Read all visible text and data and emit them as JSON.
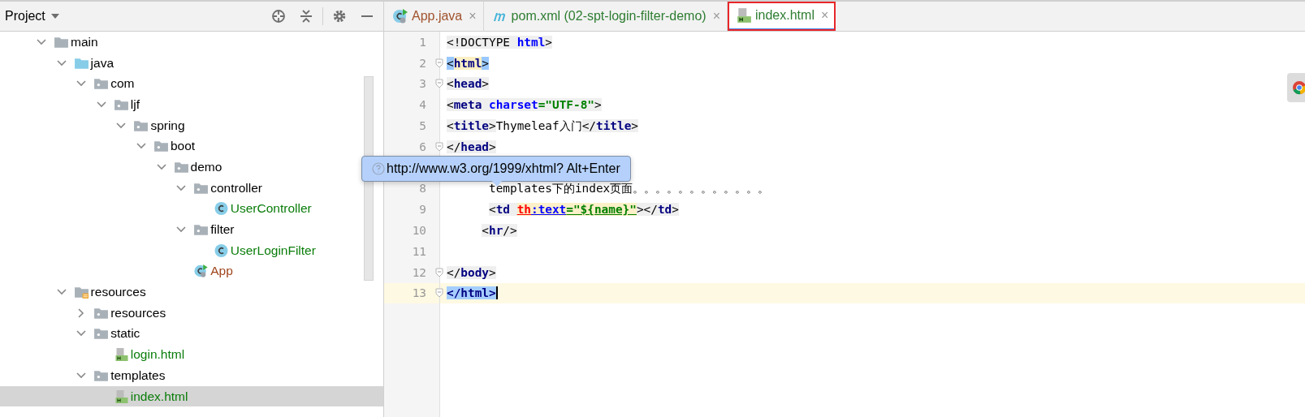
{
  "project_panel": {
    "title": "Project",
    "tree": [
      {
        "name": "main",
        "kind": "folder",
        "expanded": true,
        "selected": false,
        "children": [
          {
            "name": "java",
            "kind": "source_folder",
            "expanded": true,
            "selected": false,
            "children": [
              {
                "name": "com",
                "kind": "package",
                "expanded": true,
                "selected": false,
                "children": [
                  {
                    "name": "ljf",
                    "kind": "package",
                    "expanded": true,
                    "selected": false,
                    "children": [
                      {
                        "name": "spring",
                        "kind": "package",
                        "expanded": true,
                        "selected": false,
                        "children": [
                          {
                            "name": "boot",
                            "kind": "package",
                            "expanded": true,
                            "selected": false,
                            "children": [
                              {
                                "name": "demo",
                                "kind": "package",
                                "expanded": true,
                                "selected": false,
                                "children": [
                                  {
                                    "name": "controller",
                                    "kind": "package",
                                    "expanded": true,
                                    "selected": false,
                                    "children": [
                                      {
                                        "name": "UserController",
                                        "kind": "class",
                                        "selected": false
                                      }
                                    ]
                                  },
                                  {
                                    "name": "filter",
                                    "kind": "package",
                                    "expanded": true,
                                    "selected": false,
                                    "children": [
                                      {
                                        "name": "UserLoginFilter",
                                        "kind": "class",
                                        "selected": false
                                      }
                                    ]
                                  },
                                  {
                                    "name": "App",
                                    "kind": "app",
                                    "selected": false
                                  }
                                ]
                              }
                            ]
                          }
                        ]
                      }
                    ]
                  }
                ]
              }
            ]
          },
          {
            "name": "resources",
            "kind": "resource_folder",
            "expanded": true,
            "selected": false,
            "children": [
              {
                "name": "resources",
                "kind": "package",
                "expanded": false,
                "selected": false
              },
              {
                "name": "static",
                "kind": "package",
                "expanded": true,
                "selected": false,
                "children": [
                  {
                    "name": "login.html",
                    "kind": "html",
                    "selected": false
                  }
                ]
              },
              {
                "name": "templates",
                "kind": "package",
                "expanded": true,
                "selected": false,
                "children": [
                  {
                    "name": "index.html",
                    "kind": "html",
                    "selected": true
                  }
                ]
              }
            ]
          }
        ]
      }
    ]
  },
  "tabs": [
    {
      "label": "App.java",
      "kind": "app",
      "color": "#a0522d",
      "selected": false,
      "highlighted": false,
      "close": "×"
    },
    {
      "label": "pom.xml (02-spt-login-filter-demo)",
      "kind": "maven",
      "color": "#2e7d32",
      "selected": false,
      "highlighted": false,
      "close": "×"
    },
    {
      "label": "index.html",
      "kind": "html",
      "color": "#2e7d32",
      "selected": true,
      "highlighted": true,
      "close": "×"
    }
  ],
  "editor": {
    "lines": [
      {
        "number": "1",
        "current": false,
        "fold": false,
        "tokens": [
          {
            "kind": "plain",
            "text": "<!DOCTYPE "
          },
          {
            "kind": "attr",
            "text": "html"
          },
          {
            "kind": "plain",
            "text": ">"
          }
        ]
      },
      {
        "number": "2",
        "current": false,
        "fold": true,
        "tokens": [
          {
            "kind": "match_bracket",
            "text": "<"
          },
          {
            "kind": "match_tag",
            "text": "html"
          },
          {
            "kind": "match_bracket",
            "text": ">"
          }
        ]
      },
      {
        "number": "3",
        "current": false,
        "fold": true,
        "tokens": [
          {
            "kind": "plain",
            "text": "<"
          },
          {
            "kind": "tag",
            "text": "head"
          },
          {
            "kind": "plain",
            "text": ">"
          }
        ]
      },
      {
        "number": "4",
        "current": false,
        "fold": false,
        "tokens": [
          {
            "kind": "plain",
            "text": "<"
          },
          {
            "kind": "tag",
            "text": "meta "
          },
          {
            "kind": "attr",
            "text": "charset"
          },
          {
            "kind": "value",
            "text": "=\"UTF-8\""
          },
          {
            "kind": "plain",
            "text": ">"
          }
        ]
      },
      {
        "number": "5",
        "current": false,
        "fold": false,
        "tokens": [
          {
            "kind": "plain",
            "text": "<"
          },
          {
            "kind": "tag",
            "text": "title"
          },
          {
            "kind": "plain",
            "text": ">"
          },
          {
            "kind": "text",
            "text": "Thymeleaf入门"
          },
          {
            "kind": "plain",
            "text": "</"
          },
          {
            "kind": "tag",
            "text": "title"
          },
          {
            "kind": "plain",
            "text": ">"
          }
        ]
      },
      {
        "number": "6",
        "current": false,
        "fold": true,
        "tokens": [
          {
            "kind": "plain",
            "text": "</"
          },
          {
            "kind": "tag",
            "text": "head"
          },
          {
            "kind": "plain",
            "text": ">"
          }
        ]
      },
      {
        "covered": true
      },
      {
        "number": "8",
        "current": false,
        "fold": false,
        "kind": "deep",
        "tokens": [
          {
            "kind": "text",
            "text": "templates下的index页面。。。。。。。。。。。。"
          }
        ]
      },
      {
        "number": "9",
        "current": false,
        "fold": false,
        "kind": "deep",
        "tokens": [
          {
            "kind": "plain",
            "text": "<"
          },
          {
            "kind": "tag",
            "text": "td "
          },
          {
            "kind": "error",
            "text": "th"
          },
          {
            "kind": "attr_u",
            "text": ":text"
          },
          {
            "kind": "value_u",
            "text": "=\"${name}\""
          },
          {
            "kind": "plain",
            "text": "></"
          },
          {
            "kind": "tag",
            "text": "td"
          },
          {
            "kind": "plain",
            "text": ">"
          }
        ]
      },
      {
        "number": "10",
        "current": false,
        "fold": false,
        "kind": "medium",
        "tokens": [
          {
            "kind": "plain",
            "text": "<"
          },
          {
            "kind": "tag",
            "text": "hr"
          },
          {
            "kind": "plain",
            "text": "/>"
          }
        ]
      },
      {
        "number": "11",
        "current": false,
        "fold": false
      },
      {
        "number": "12",
        "current": false,
        "fold": true,
        "tokens": [
          {
            "kind": "plain",
            "text": "</"
          },
          {
            "kind": "tag",
            "text": "body"
          },
          {
            "kind": "plain",
            "text": ">"
          }
        ]
      },
      {
        "number": "13",
        "current": true,
        "fold": true,
        "tokens": [
          {
            "kind": "match_all",
            "text": "</html>"
          }
        ]
      }
    ],
    "tooltip": {
      "text": "http://www.w3.org/1999/xhtml? Alt+Enter"
    }
  }
}
